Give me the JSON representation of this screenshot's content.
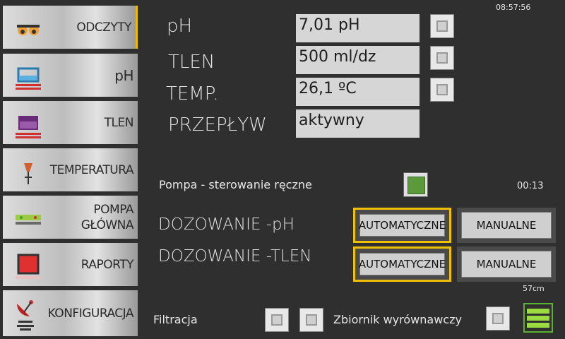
{
  "clock": "08:57:56",
  "sidebar": {
    "items": [
      {
        "label": "ODCZYTY",
        "icon": "readings-icon"
      },
      {
        "label": "pH",
        "icon": "beaker-icon"
      },
      {
        "label": "TLEN",
        "icon": "tank-icon"
      },
      {
        "label": "TEMPERATURA",
        "icon": "thermometer-icon"
      },
      {
        "label": "POMPA GŁÓWNA",
        "label1": "POMPA",
        "label2": "GŁÓWNA",
        "icon": "pump-icon"
      },
      {
        "label": "RAPORTY",
        "icon": "report-icon"
      },
      {
        "label": "KONFIGURACJA",
        "icon": "antenna-icon"
      }
    ]
  },
  "readings": {
    "ph": {
      "label": "pH",
      "value": "7,01 pH"
    },
    "oxygen": {
      "label": "TLEN",
      "value": "500 ml/dz"
    },
    "temp": {
      "label": "TEMP.",
      "value": "26,1 ºC"
    },
    "flow": {
      "label": "PRZEPŁYW",
      "value": "aktywny"
    }
  },
  "pump_manual": {
    "label": "Pompa - sterowanie ręczne",
    "timer": "00:13"
  },
  "dosing": {
    "ph": {
      "label": "DOZOWANIE -pH",
      "auto": "AUTOMATYCZNE",
      "manual": "MANUALNE"
    },
    "oxygen": {
      "label": "DOZOWANIE -TLEN",
      "auto": "AUTOMATYCZNE",
      "manual": "MANUALNE"
    }
  },
  "level": "57cm",
  "filtration": {
    "label": "Filtracja"
  },
  "tank": {
    "label": "Zbiornik wyrównawczy"
  },
  "colors": {
    "accent": "#f0c000",
    "active_green": "#5a9a3a",
    "background": "#2f2f2f"
  }
}
